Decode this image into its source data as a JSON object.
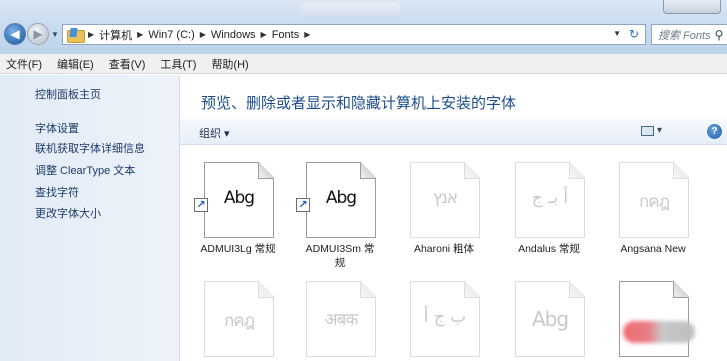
{
  "address": {
    "crumbs": [
      "计算机",
      "Win7 (C:)",
      "Windows",
      "Fonts"
    ],
    "search_placeholder": "搜索 Fonts"
  },
  "menu": [
    "文件(F)",
    "编辑(E)",
    "查看(V)",
    "工具(T)",
    "帮助(H)"
  ],
  "sidebar": {
    "items": [
      "控制面板主页",
      "字体设置",
      "联机获取字体详细信息",
      "调整 ClearType 文本",
      "查找字符",
      "更改字体大小"
    ]
  },
  "main": {
    "header": "预览、删除或者显示和隐藏计算机上安装的字体",
    "toolbar": {
      "organize": "组织 ▾",
      "views_arrow": "▾",
      "help": "?"
    },
    "fonts_row1": [
      {
        "sample": "Abg",
        "caption": "ADMUI3Lg 常规",
        "shortcut": true,
        "faded": false
      },
      {
        "sample": "Abg",
        "caption": "ADMUI3Sm 常规",
        "shortcut": true,
        "faded": false
      },
      {
        "sample": "אנץ",
        "caption": "Aharoni 粗体",
        "shortcut": false,
        "faded": true
      },
      {
        "sample": "أ بـ ج",
        "caption": "Andalus 常规",
        "shortcut": false,
        "faded": true
      },
      {
        "sample": "กคฎ",
        "caption": "Angsana New",
        "shortcut": false,
        "faded": true
      }
    ],
    "fonts_row2": [
      {
        "sample": "กคฎ",
        "faded": true
      },
      {
        "sample": "अबक",
        "faded": true
      },
      {
        "sample": "ب ج أ",
        "faded": true
      },
      {
        "sample": "Abg",
        "faded": true
      },
      {
        "sample": "",
        "faded": false
      }
    ]
  }
}
